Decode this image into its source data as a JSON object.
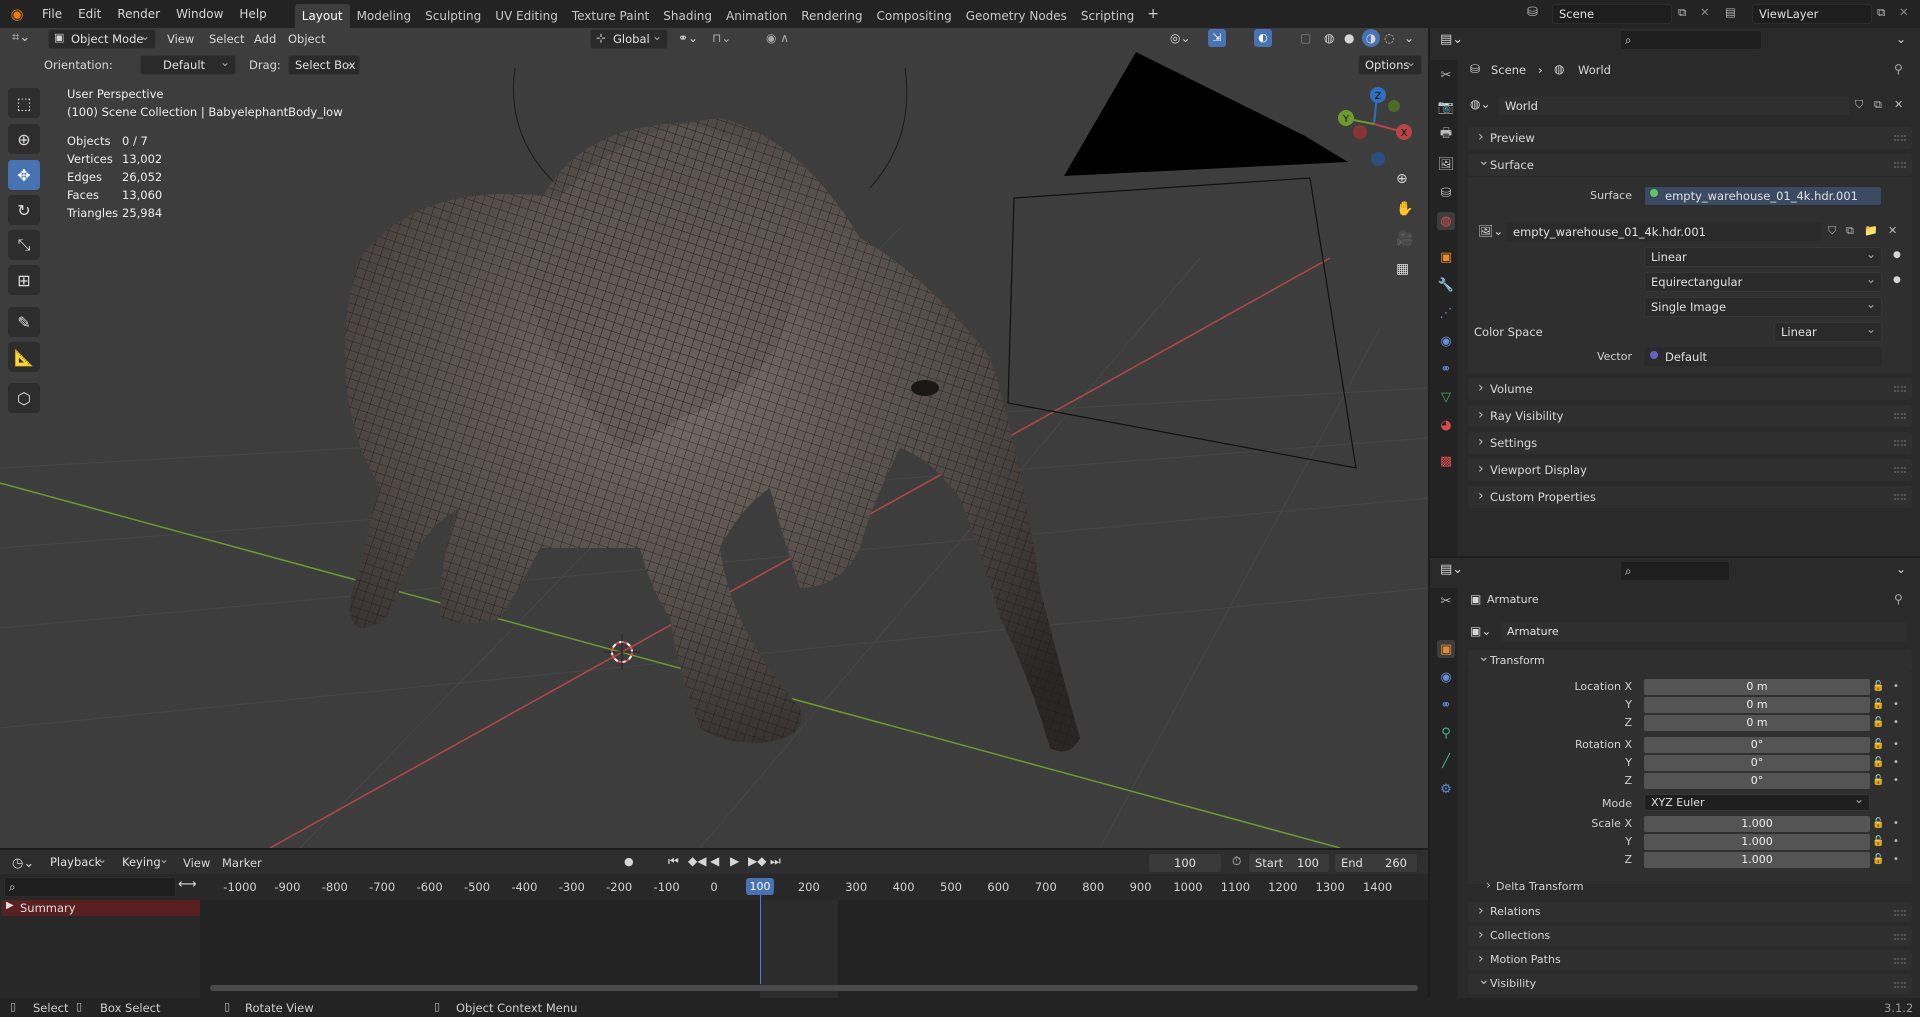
{
  "app": {
    "version": "3.1.2"
  },
  "menu": {
    "file": "File",
    "edit": "Edit",
    "render": "Render",
    "window": "Window",
    "help": "Help"
  },
  "workspaces": [
    "Layout",
    "Modeling",
    "Sculpting",
    "UV Editing",
    "Texture Paint",
    "Shading",
    "Animation",
    "Rendering",
    "Compositing",
    "Geometry Nodes",
    "Scripting"
  ],
  "scene": {
    "name": "Scene",
    "view_layer": "ViewLayer"
  },
  "viewport_header": {
    "mode": "Object Mode",
    "view": "View",
    "select": "Select",
    "add": "Add",
    "object": "Object",
    "transform_orientation": "Global",
    "orientation_label": "Orientation:",
    "orientation_value": "Default",
    "drag_label": "Drag:",
    "drag_value": "Select Box",
    "options": "Options"
  },
  "viewport_overlay": {
    "perspective": "User Perspective",
    "collection": "(100) Scene Collection | BabyelephantBody_low",
    "stats": [
      {
        "label": "Objects",
        "value": "0 / 7"
      },
      {
        "label": "Vertices",
        "value": "13,002"
      },
      {
        "label": "Edges",
        "value": "26,052"
      },
      {
        "label": "Faces",
        "value": "13,060"
      },
      {
        "label": "Triangles",
        "value": "25,984"
      }
    ]
  },
  "gizmo": {
    "x": "X",
    "y": "Y",
    "z": "Z"
  },
  "world_panel": {
    "breadcrumb_scene": "Scene",
    "breadcrumb_world": "World",
    "world_name": "World",
    "sections": {
      "preview": "Preview",
      "surface": "Surface",
      "volume": "Volume",
      "ray_visibility": "Ray Visibility",
      "settings": "Settings",
      "viewport_display": "Viewport Display",
      "custom_properties": "Custom Properties"
    },
    "surface_label": "Surface",
    "surface_value": "empty_warehouse_01_4k.hdr.001",
    "image_name": "empty_warehouse_01_4k.hdr.001",
    "interpolation": "Linear",
    "projection": "Equirectangular",
    "source": "Single Image",
    "color_space_label": "Color Space",
    "color_space_value": "Linear",
    "vector_label": "Vector",
    "vector_value": "Default"
  },
  "object_panel": {
    "object_name": "Armature",
    "data_name": "Armature",
    "transform": "Transform",
    "location_x_label": "Location X",
    "y_label": "Y",
    "z_label": "Z",
    "rotation_x_label": "Rotation X",
    "scale_x_label": "Scale X",
    "mode_label": "Mode",
    "mode_value": "XYZ Euler",
    "location": [
      "0 m",
      "0 m",
      "0 m"
    ],
    "rotation": [
      "0°",
      "0°",
      "0°"
    ],
    "scale": [
      "1.000",
      "1.000",
      "1.000"
    ],
    "delta_transform": "Delta Transform",
    "sections": {
      "relations": "Relations",
      "collections": "Collections",
      "motion_paths": "Motion Paths",
      "visibility": "Visibility"
    }
  },
  "timeline": {
    "playback": "Playback",
    "keying": "Keying",
    "view": "View",
    "marker": "Marker",
    "current_frame": "100",
    "start_label": "Start",
    "start_value": "100",
    "end_label": "End",
    "end_value": "260",
    "ticks": [
      "-1000",
      "-900",
      "-800",
      "-700",
      "-600",
      "-500",
      "-400",
      "-300",
      "-200",
      "-100",
      "0",
      "100",
      "200",
      "300",
      "400",
      "500",
      "600",
      "700",
      "800",
      "900",
      "1000",
      "1100",
      "1200",
      "1300",
      "1400"
    ],
    "playhead": "100",
    "summary": "Summary"
  },
  "status_bar": {
    "select": "Select",
    "box_select": "Box Select",
    "rotate_view": "Rotate View",
    "context_menu": "Object Context Menu"
  },
  "colors": {
    "accent": "#4772b3",
    "bg": "#1d1d1d",
    "viewport": "#3d3d3d",
    "x_axis": "#b84545",
    "y_axis": "#6e9a2b",
    "z_axis": "#2f6fbf"
  }
}
